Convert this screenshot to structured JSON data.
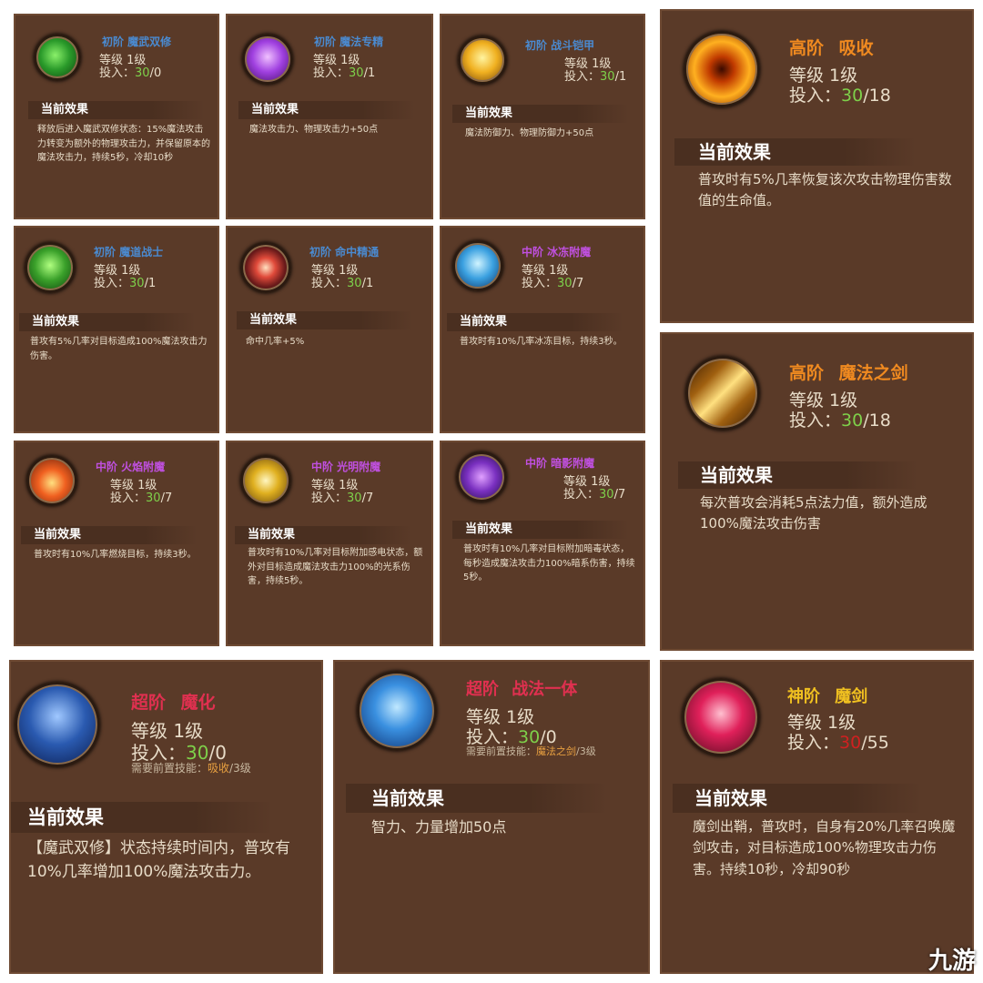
{
  "cards": [
    {
      "tier": "初阶 魔武双修",
      "level": "等级 1级",
      "invest_label": "投入：",
      "invest_num": "30",
      "invest_max": "/0",
      "effect_title": "当前效果",
      "desc": "释放后进入魔武双修状态：15%魔法攻击力转变为额外的物理攻击力，并保留原本的魔法攻击力，持续5秒，冷却10秒",
      "icon": "green-swirl-icon",
      "color": "#4a8ad0"
    },
    {
      "tier": "初阶 魔法专精",
      "level": "等级 1级",
      "invest_label": "投入：",
      "invest_num": "30",
      "invest_max": "/1",
      "effect_title": "当前效果",
      "desc": "魔法攻击力、物理攻击力+50点",
      "icon": "purple-totem-icon",
      "color": "#4a8ad0"
    },
    {
      "tier": "初阶 战斗铠甲",
      "level": "等级 1级",
      "invest_label": "投入：",
      "invest_num": "30",
      "invest_max": "/1",
      "effect_title": "当前效果",
      "desc": "魔法防御力、物理防御力+50点",
      "icon": "golden-star-icon",
      "color": "#4a8ad0"
    },
    {
      "tier": "高阶 吸收",
      "level": "等级 1级",
      "invest_label": "投入：",
      "invest_num": "30",
      "invest_max": "/18",
      "effect_title": "当前效果",
      "desc": "普攻时有5%几率恢复该次攻击物理伤害数值的生命值。",
      "icon": "fire-vortex-icon",
      "color": "#f08a20"
    },
    {
      "tier": "初阶 魔道战士",
      "level": "等级 1级",
      "invest_label": "投入：",
      "invest_num": "30",
      "invest_max": "/1",
      "effect_title": "当前效果",
      "desc": "普攻有5%几率对目标造成100%魔法攻击力伤害。",
      "icon": "green-warrior-icon",
      "color": "#4a8ad0"
    },
    {
      "tier": "初阶 命中精通",
      "level": "等级 1级",
      "invest_label": "投入：",
      "invest_num": "30",
      "invest_max": "/1",
      "effect_title": "当前效果",
      "desc": "命中几率+5%",
      "icon": "red-target-icon",
      "color": "#4a8ad0"
    },
    {
      "tier": "中阶 冰冻附魔",
      "level": "等级 1级",
      "invest_label": "投入：",
      "invest_num": "30",
      "invest_max": "/7",
      "effect_title": "当前效果",
      "desc": "普攻时有10%几率冰冻目标，持续3秒。",
      "icon": "ice-crystal-icon",
      "color": "#c050e0"
    },
    {
      "tier": "高阶 魔法之剑",
      "level": "等级 1级",
      "invest_label": "投入：",
      "invest_num": "30",
      "invest_max": "/18",
      "effect_title": "当前效果",
      "desc": "每次普攻会消耗5点法力值，额外造成100%魔法攻击伤害",
      "icon": "golden-sword-icon",
      "color": "#f08a20"
    },
    {
      "tier": "中阶 火焰附魔",
      "level": "等级 1级",
      "invest_label": "投入：",
      "invest_num": "30",
      "invest_max": "/7",
      "effect_title": "当前效果",
      "desc": "普攻时有10%几率燃烧目标，持续3秒。",
      "icon": "flame-icon",
      "color": "#c050e0"
    },
    {
      "tier": "中阶 光明附魔",
      "level": "等级 1级",
      "invest_label": "投入：",
      "invest_num": "30",
      "invest_max": "/7",
      "effect_title": "当前效果",
      "desc": "普攻时有10%几率对目标附加感电状态，额外对目标造成魔法攻击力100%的光系伤害，持续5秒。",
      "icon": "lightning-icon",
      "color": "#c050e0"
    },
    {
      "tier": "中阶 暗影附魔",
      "level": "等级 1级",
      "invest_label": "投入：",
      "invest_num": "30",
      "invest_max": "/7",
      "effect_title": "当前效果",
      "desc": "普攻时有10%几率对目标附加暗毒状态，每秒造成魔法攻击力100%暗系伤害，持续5秒。",
      "icon": "dark-orb-icon",
      "color": "#c050e0"
    },
    {
      "tier": "超阶 魔化",
      "level": "等级 1级",
      "invest_label": "投入：",
      "invest_num": "30",
      "invest_max": "/0",
      "req_prefix": "需要前置技能：",
      "req_skill": "吸收",
      "req_suffix": "/3级",
      "effect_title": "当前效果",
      "desc": "【魔武双修】状态持续时间内，普攻有10%几率增加100%魔法攻击力。",
      "icon": "hooded-mage-icon",
      "color": "#e03050"
    },
    {
      "tier": "超阶 战法一体",
      "level": "等级 1级",
      "invest_label": "投入：",
      "invest_num": "30",
      "invest_max": "/0",
      "req_prefix": "需要前置技能：",
      "req_skill": "魔法之剑",
      "req_suffix": "/3级",
      "effect_title": "当前效果",
      "desc": "智力、力量增加50点",
      "icon": "blue-knight-icon",
      "color": "#e03050"
    },
    {
      "tier": "神阶 魔剑",
      "level": "等级 1级",
      "invest_label": "投入：",
      "invest_num": "30",
      "invest_max": "/55",
      "effect_title": "当前效果",
      "desc": "魔剑出鞘，普攻时，自身有20%几率召唤魔剑攻击，对目标造成100%物理攻击力伤害。持续10秒，冷却90秒",
      "icon": "crimson-blade-icon",
      "color": "#f0c020"
    }
  ],
  "watermark": "九游"
}
